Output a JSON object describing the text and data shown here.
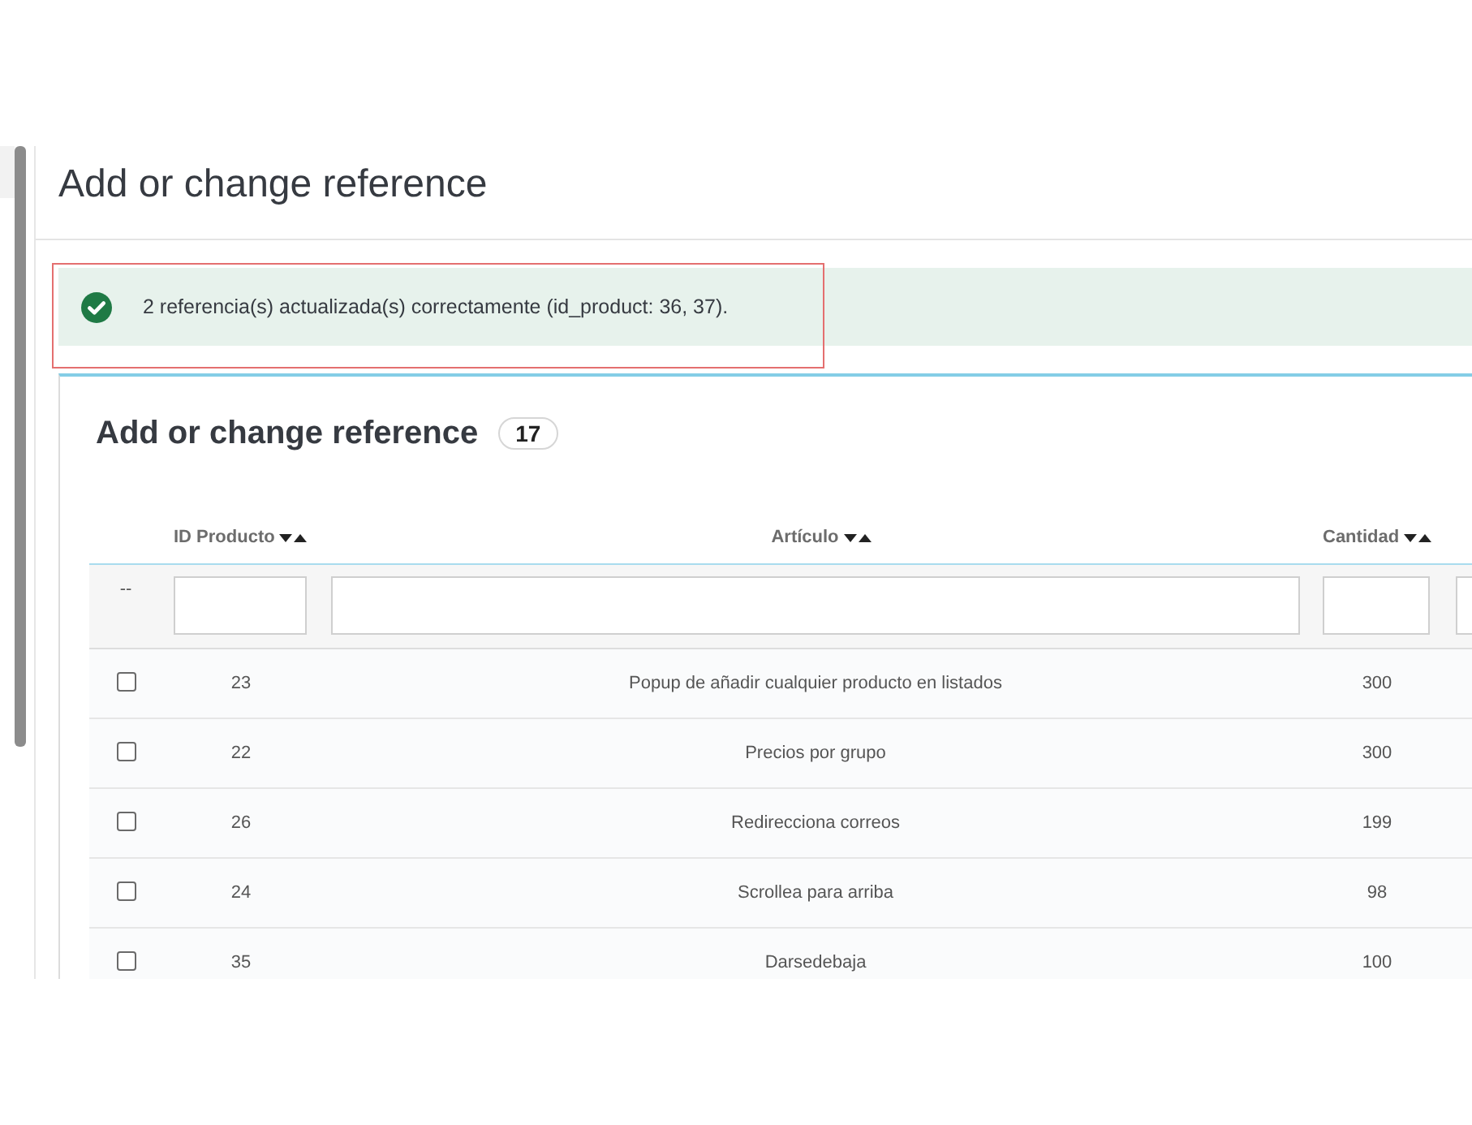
{
  "page": {
    "title": "Add or change reference"
  },
  "alert": {
    "kind": "success",
    "message": "2 referencia(s) actualizada(s) correctamente (id_product: 36, 37).",
    "highlighted": true
  },
  "panel": {
    "title": "Add or change reference",
    "count": "17"
  },
  "table": {
    "columns": [
      {
        "label": "ID Producto",
        "sortable": true
      },
      {
        "label": "Artículo",
        "sortable": true
      },
      {
        "label": "Cantidad",
        "sortable": true
      }
    ],
    "filter_reset": "--",
    "rows": [
      {
        "checked": false,
        "cells": [
          "23",
          "Popup de añadir cualquier producto en listados",
          "300"
        ]
      },
      {
        "checked": false,
        "cells": [
          "22",
          "Precios por grupo",
          "300"
        ]
      },
      {
        "checked": false,
        "cells": [
          "26",
          "Redirecciona correos",
          "199"
        ]
      },
      {
        "checked": false,
        "cells": [
          "24",
          "Scrollea para arriba",
          "98"
        ]
      },
      {
        "checked": false,
        "cells": [
          "35",
          "Darsedebaja",
          "100"
        ]
      }
    ]
  }
}
